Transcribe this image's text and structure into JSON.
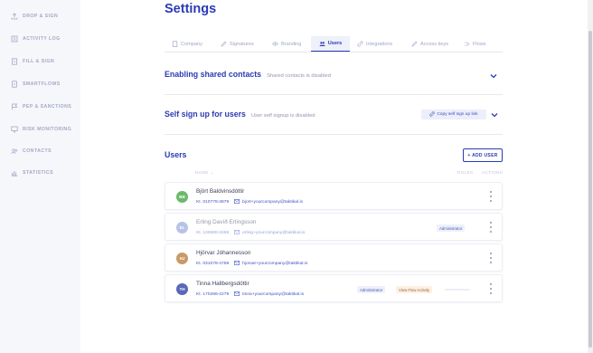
{
  "sidebar": {
    "items": [
      {
        "label": "DROP & SIGN",
        "icon": "upload-icon"
      },
      {
        "label": "ACTIVITY LOG",
        "icon": "log-icon"
      },
      {
        "label": "FILL & SIGN",
        "icon": "document-icon"
      },
      {
        "label": "SMARTFLOWS",
        "icon": "flow-icon"
      },
      {
        "label": "PEP & SANCTIONS",
        "icon": "flag-icon"
      },
      {
        "label": "RISK MONITORING",
        "icon": "monitor-icon"
      },
      {
        "label": "CONTACTS",
        "icon": "contacts-icon"
      },
      {
        "label": "STATISTICS",
        "icon": "chart-icon"
      }
    ]
  },
  "page": {
    "title": "Settings"
  },
  "tabs": [
    {
      "label": "Company",
      "icon": "building-icon"
    },
    {
      "label": "Signatures",
      "icon": "pen-icon"
    },
    {
      "label": "Branding",
      "icon": "eye-icon"
    },
    {
      "label": "Users",
      "icon": "users-icon",
      "active": true
    },
    {
      "label": "Integrations",
      "icon": "link-icon"
    },
    {
      "label": "Access keys",
      "icon": "key-icon"
    },
    {
      "label": "Flows",
      "icon": "flows-icon"
    }
  ],
  "shared_contacts": {
    "title": "Enabling shared contacts",
    "status": "Shared contacts is disabled"
  },
  "self_signup": {
    "title": "Self sign up for users",
    "status": "User self signup is disabled",
    "copy_label": "Copy self sign up link"
  },
  "users": {
    "heading": "Users",
    "add_label": "+ ADD USER",
    "columns": {
      "name": "NAME",
      "roles": "ROLES",
      "actions": "ACTIONS"
    },
    "list": [
      {
        "initials": "BB",
        "name": "Björt Baldvinsdóttir",
        "kt": "Kt. 010778-3879",
        "email": "bjort+yourcompany@taktikal.is",
        "roles": [],
        "avatar_color": "#6cb96a",
        "muted": false
      },
      {
        "initials": "EL",
        "name": "Erling Davíð Erlingsson",
        "kt": "Kt. 130690-3469",
        "email": "erling+yourcompany@taktikal.is",
        "roles": [
          "Administrator"
        ],
        "avatar_color": "#9fb0dc",
        "muted": true
      },
      {
        "initials": "HJ",
        "name": "Hjörvar Jóhannesson",
        "kt": "Kt. 031078-4759",
        "email": "hjorvar+yourcompany@taktikal.is",
        "roles": [],
        "avatar_color": "#c79a68",
        "muted": false
      },
      {
        "initials": "TH",
        "name": "Tinna Hallbergsdóttir",
        "kt": "Kt. 170286-2279",
        "email": "tinna+yourcompany@taktikal.is",
        "roles": [
          "Administrator",
          "View Flow Activity"
        ],
        "avatar_color": "#5a68b8",
        "muted": false
      }
    ]
  },
  "colors": {
    "accent": "#2b3bb5",
    "sidebar_bg": "#f6f7fb",
    "muted_text": "#a3a8c4"
  }
}
